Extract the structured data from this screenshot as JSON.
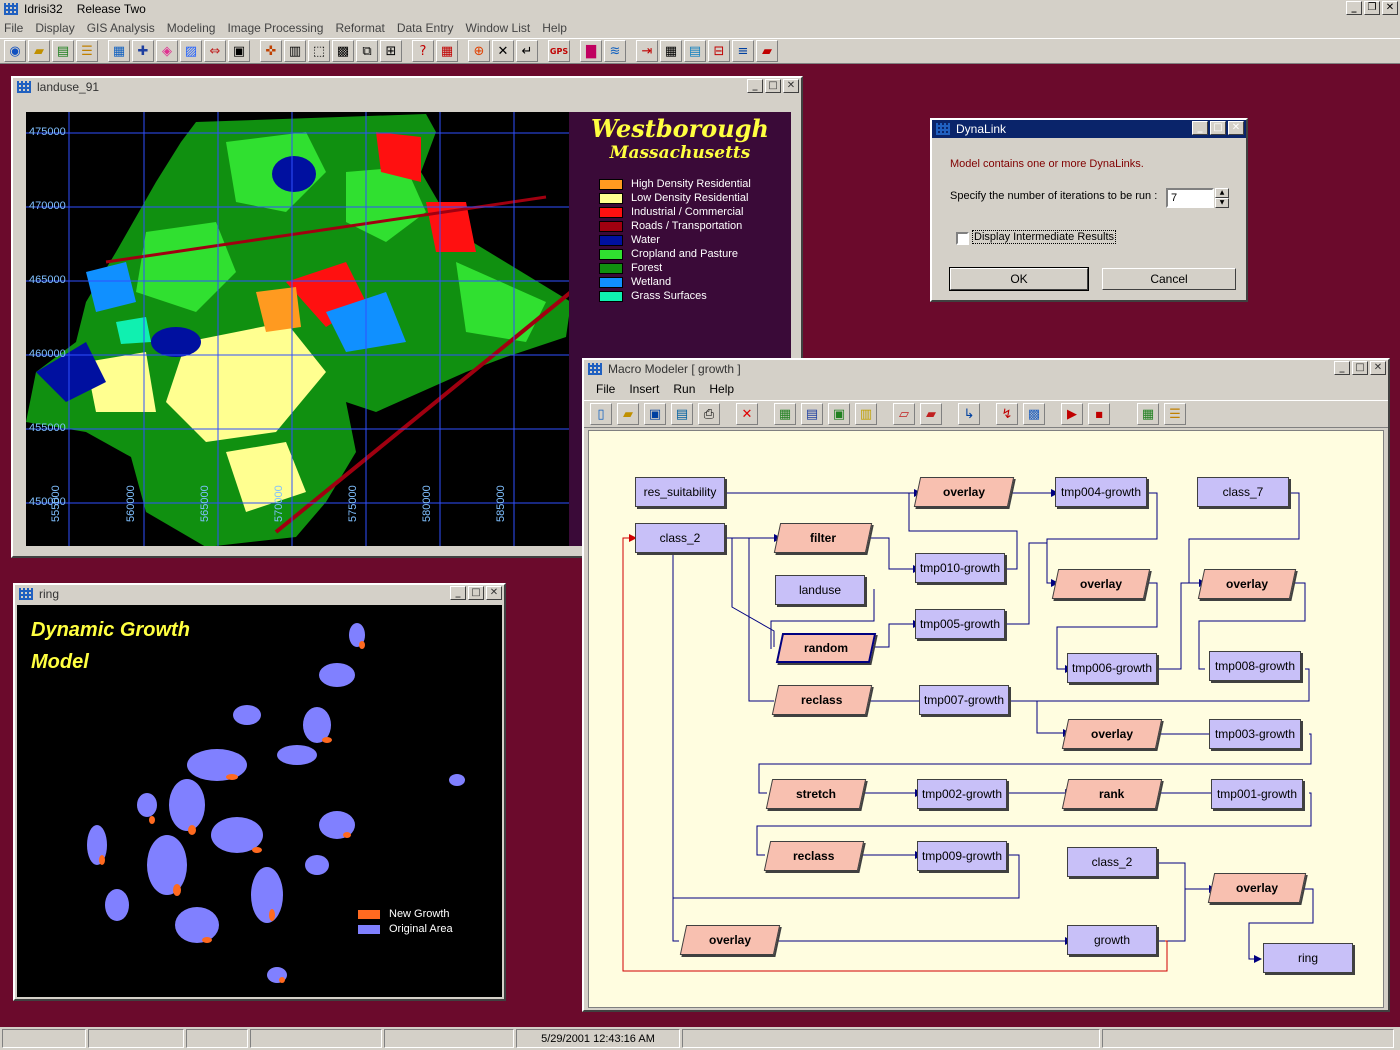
{
  "app": {
    "title": "Idrisi32",
    "release": "Release Two",
    "menu": [
      "File",
      "Display",
      "GIS Analysis",
      "Modeling",
      "Image Processing",
      "Reformat",
      "Data Entry",
      "Window List",
      "Help"
    ]
  },
  "landuse_window": {
    "title": "landuse_91",
    "map_title": "Westborough",
    "map_subtitle": "Massachusetts",
    "y_ticks": [
      "475000",
      "470000",
      "465000",
      "460000",
      "455000",
      "450000"
    ],
    "x_ticks": [
      "555000",
      "560000",
      "565000",
      "570000",
      "575000",
      "580000",
      "585000"
    ],
    "legend": [
      {
        "label": "High Density Residential",
        "color": "#ff9a20"
      },
      {
        "label": "Low Density Residential",
        "color": "#ffff90"
      },
      {
        "label": "Industrial / Commercial",
        "color": "#ff1010"
      },
      {
        "label": "Roads / Transportation",
        "color": "#a00010"
      },
      {
        "label": "Water",
        "color": "#0010a0"
      },
      {
        "label": "Cropland and Pasture",
        "color": "#30e030"
      },
      {
        "label": "Forest",
        "color": "#109010"
      },
      {
        "label": "Wetland",
        "color": "#1090ff"
      },
      {
        "label": "Grass Surfaces",
        "color": "#10f0b0"
      }
    ]
  },
  "ring_window": {
    "title": "ring",
    "heading_line1": "Dynamic Growth",
    "heading_line2": "Model",
    "legend": [
      {
        "label": "New Growth",
        "color": "#ff6a20"
      },
      {
        "label": "Original Area",
        "color": "#8080ff"
      }
    ]
  },
  "dynalink_dialog": {
    "title": "DynaLink",
    "message": "Model contains one or more DynaLinks.",
    "iterations_label": "Specify the number of iterations to be run :",
    "iterations_value": "7",
    "checkbox_label": "Display Intermediate Results",
    "checkbox_checked": false,
    "ok_label": "OK",
    "cancel_label": "Cancel"
  },
  "macro_modeler": {
    "title": "Macro Modeler  [ growth ]",
    "menu": [
      "File",
      "Insert",
      "Run",
      "Help"
    ],
    "nodes": {
      "res_suitability": "res_suitability",
      "overlay1": "overlay",
      "tmp004": "tmp004-growth",
      "class_7": "class_7",
      "class_2a": "class_2",
      "filter": "filter",
      "tmp010": "tmp010-growth",
      "overlay2": "overlay",
      "overlay3": "overlay",
      "landuse": "landuse",
      "tmp005": "tmp005-growth",
      "random": "random",
      "tmp006": "tmp006-growth",
      "tmp008": "tmp008-growth",
      "reclass1": "reclass",
      "tmp007": "tmp007-growth",
      "overlay4": "overlay",
      "tmp003": "tmp003-growth",
      "stretch": "stretch",
      "tmp002": "tmp002-growth",
      "rank": "rank",
      "tmp001": "tmp001-growth",
      "reclass2": "reclass",
      "tmp009": "tmp009-growth",
      "class_2b": "class_2",
      "overlay5": "overlay",
      "overlay6": "overlay",
      "growth": "growth",
      "ring": "ring"
    }
  },
  "statusbar": {
    "datetime": "5/29/2001 12:43:16 AM"
  }
}
